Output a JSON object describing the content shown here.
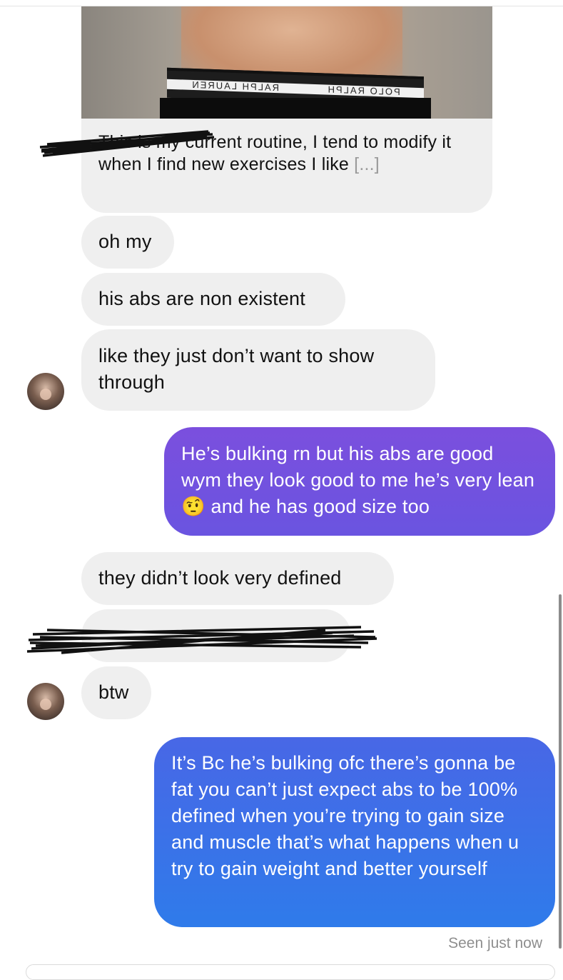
{
  "thread": {
    "photo_caption_sender_redacted": "",
    "photo_caption": "This is my current routine, I tend to modify it when I find new exercises I like",
    "photo_caption_more": "[...]",
    "messages": [
      {
        "from": "them",
        "text": "oh my"
      },
      {
        "from": "them",
        "text": "his abs are non existent"
      },
      {
        "from": "them",
        "text": "like they just don’t want to show through"
      },
      {
        "from": "me",
        "text_a": "He’s bulking rn but his abs are good wym they look good to me he’s very lean ",
        "emoji": "🤨",
        "text_b": " and he has good size too"
      },
      {
        "from": "them",
        "text": "they didn’t look very defined"
      },
      {
        "from": "them",
        "text": ""
      },
      {
        "from": "them",
        "text": "btw"
      },
      {
        "from": "me",
        "text": "It’s Bc he’s bulking ofc there’s gonna be fat you can’t just expect abs to be 100% defined when you’re trying to gain size and muscle that’s what happens when u try to gain weight and better yourself"
      }
    ],
    "photo_brand_text": [
      "POLO RALPH",
      "RALPH LAUREN"
    ],
    "status": "Seen just now"
  },
  "colors": {
    "incoming_bubble": "#efefef",
    "outgoing_purple": "#7b4fde",
    "outgoing_blue": "#3c74ea",
    "seen_text": "#8e8e8e"
  },
  "icons": {
    "avatar": "profile-avatar",
    "emoji": "face-with-raised-eyebrow"
  }
}
